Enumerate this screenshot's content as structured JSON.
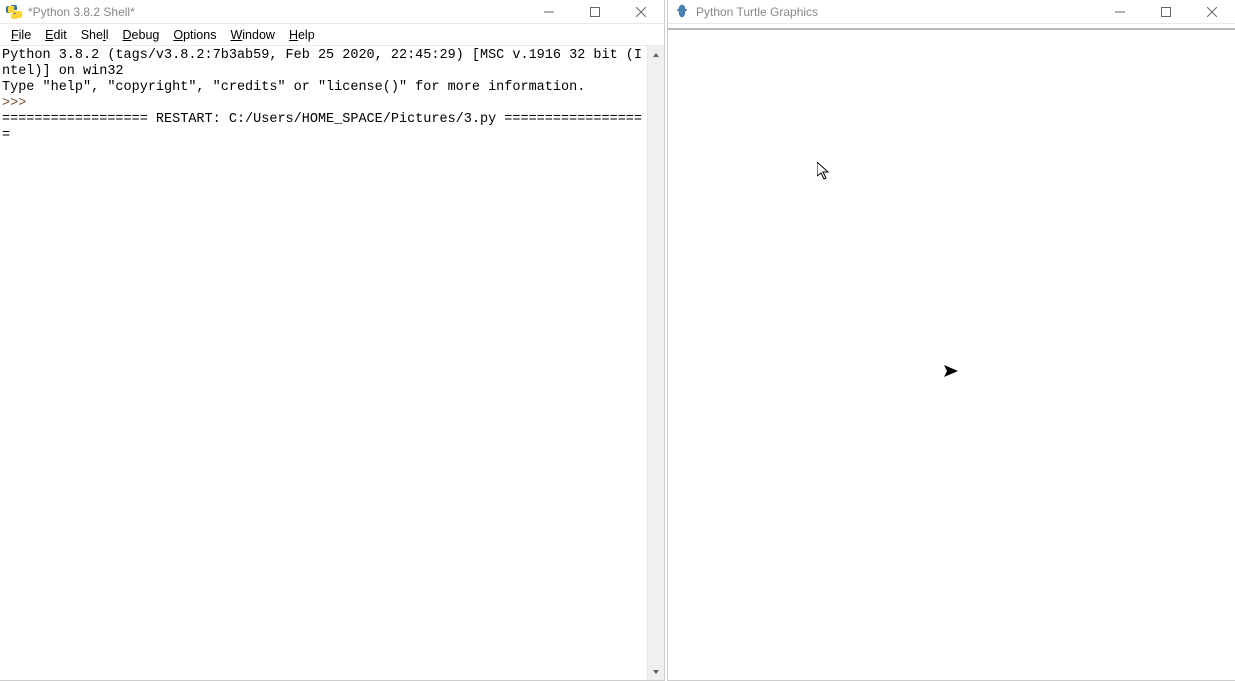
{
  "shell_window": {
    "title": "*Python 3.8.2 Shell*",
    "menu": {
      "file": "File",
      "edit": "Edit",
      "shell": "Shell",
      "debug": "Debug",
      "options": "Options",
      "window": "Window",
      "help": "Help"
    },
    "content": {
      "line1": "Python 3.8.2 (tags/v3.8.2:7b3ab59, Feb 25 2020, 22:45:29) [MSC v.1916 32 bit (Intel)] on win32",
      "line2": "Type \"help\", \"copyright\", \"credits\" or \"license()\" for more information.",
      "prompt1": ">>> ",
      "restart_line": "================== RESTART: C:/Users/HOME_SPACE/Pictures/3.py =================="
    }
  },
  "turtle_window": {
    "title": "Python Turtle Graphics"
  }
}
